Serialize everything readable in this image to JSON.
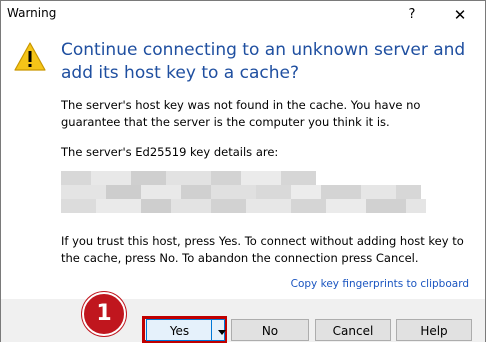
{
  "window": {
    "title": "Warning",
    "help_glyph": "?",
    "close_glyph": "✕"
  },
  "message": {
    "heading": "Continue connecting to an unknown server and add its host key to a cache?",
    "paragraph1": "The server's host key was not found in the cache. You have no guarantee that the server is the computer you think it is.",
    "paragraph2": "The server's Ed25519 key details are:",
    "paragraph3": "If you trust this host, press Yes. To connect without adding host key to the cache, press No. To abandon the connection press Cancel.",
    "copy_link": "Copy key fingerprints to clipboard"
  },
  "buttons": {
    "yes": "Yes",
    "no": "No",
    "cancel": "Cancel",
    "help": "Help"
  },
  "annotation": {
    "step_number": "1",
    "highlight_color": "#c00000"
  },
  "colors": {
    "heading": "#1f4fa0",
    "link": "#1a55c0",
    "warning_icon": "#f5c518"
  },
  "icons": [
    "warning-icon",
    "help-icon",
    "close-icon",
    "chevron-down-icon"
  ]
}
